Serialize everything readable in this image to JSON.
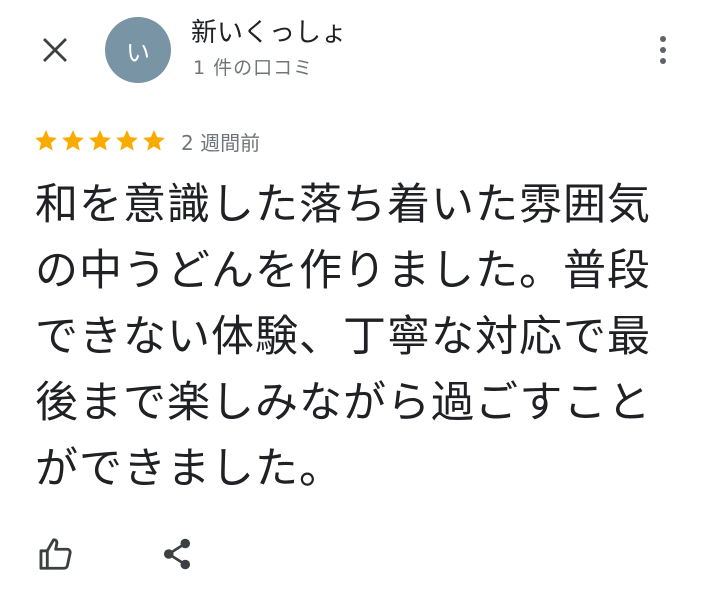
{
  "header": {
    "close_icon": "close-icon",
    "avatar_initial": "い",
    "avatar_color": "#7894a5",
    "author_name": "新いくっしょ",
    "author_meta": "1 件の口コミ",
    "more_icon": "more-vert-icon"
  },
  "review": {
    "rating": 5,
    "rating_max": 5,
    "star_color": "#f9ab00",
    "date": "2 週間前",
    "text": "和を意識した落ち着いた雰囲気の中うどんを作りました。普段できない体験、丁寧な対応で最後まで楽しみながら過ごすことができました。"
  },
  "actions": {
    "like_icon": "thumb-up-icon",
    "share_icon": "share-icon"
  }
}
